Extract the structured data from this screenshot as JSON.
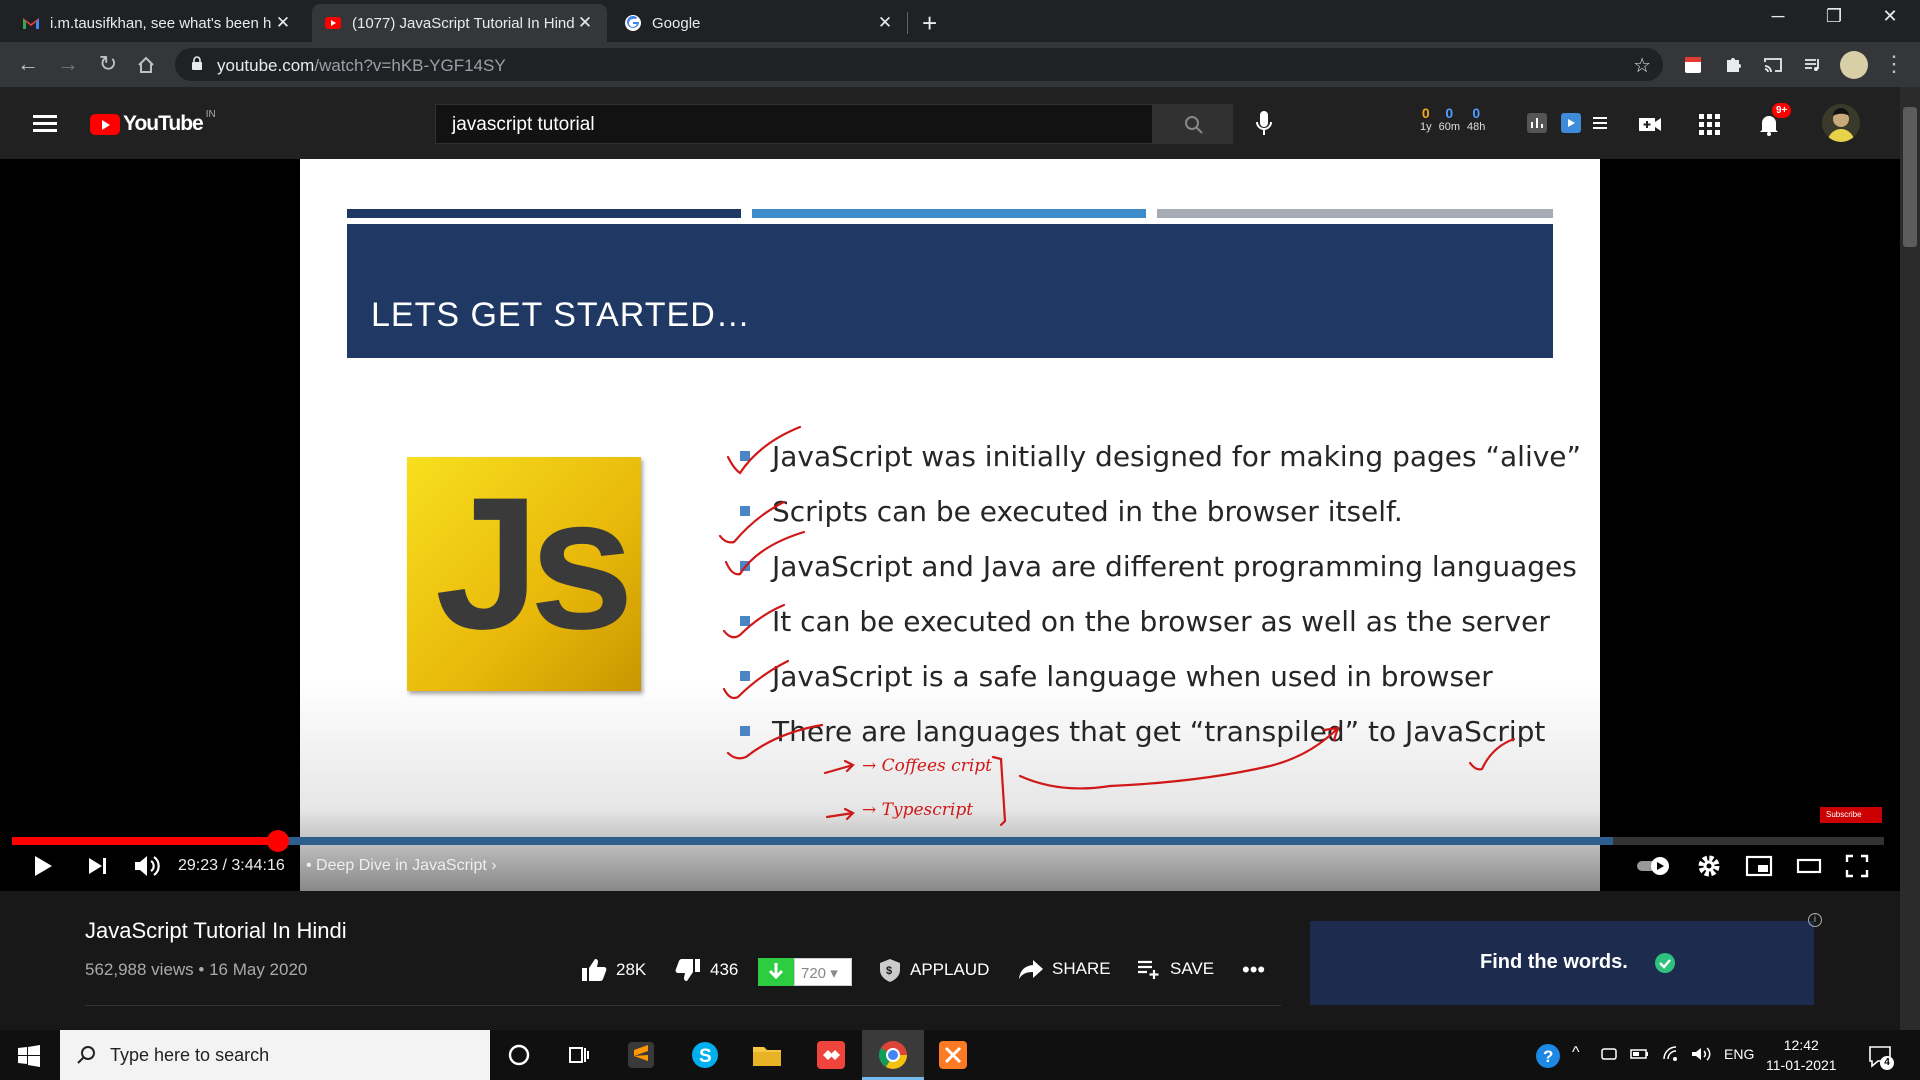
{
  "browser": {
    "tabs": [
      {
        "title": "i.m.tausifkhan, see what's been h",
        "favicon": "gmail-icon",
        "active": false
      },
      {
        "title": "(1077) JavaScript Tutorial In Hind",
        "favicon": "youtube-icon",
        "active": true
      },
      {
        "title": "Google",
        "favicon": "google-icon",
        "active": false
      }
    ],
    "new_tab": "+",
    "url_domain": "youtube.com",
    "url_path": "/watch?v=hKB-YGF14SY"
  },
  "youtube": {
    "logo_text": "YouTube",
    "country_code": "IN",
    "search_query": "javascript tutorial",
    "counters": [
      {
        "value": "0",
        "label": "1y",
        "color": "#f5a623"
      },
      {
        "value": "0",
        "label": "60m",
        "color": "#4a9eff"
      },
      {
        "value": "0",
        "label": "48h",
        "color": "#4a9eff"
      }
    ],
    "notification_badge": "9+"
  },
  "slide": {
    "heading": "LETS GET STARTED…",
    "logo_text": "Js",
    "bullets": [
      "JavaScript was initially designed for making pages “alive”",
      "Scripts can be executed in the browser itself.",
      "JavaScript and Java are different programming languages",
      "It can be executed on the browser as well as the server",
      "JavaScript is a safe language when used in browser",
      "There are languages that get “transpiled” to JavaScript"
    ],
    "handwritten_notes": [
      "→ Coffees cript",
      "→ Typescript"
    ],
    "subscribe_chip": "Subscribe"
  },
  "player": {
    "progress_fraction": 0.1419,
    "buffered_fraction": 0.855,
    "time_current": "29:23",
    "time_total": "3:44:16",
    "time_display": "29:23 / 3:44:16",
    "chapter": "Deep Dive in JavaScript",
    "accent": "#ff0000"
  },
  "video": {
    "title": "JavaScript Tutorial In Hindi",
    "meta": "562,988 views • 16 May 2020",
    "likes": "28K",
    "dislikes": "436",
    "download_count": "720",
    "applaud": "APPLAUD",
    "share": "SHARE",
    "save": "SAVE"
  },
  "ad": {
    "text": "Find the words."
  },
  "taskbar": {
    "search_placeholder": "Type here to search",
    "language": "ENG",
    "time": "12:42",
    "date": "11-01-2021",
    "notifications": "4"
  }
}
